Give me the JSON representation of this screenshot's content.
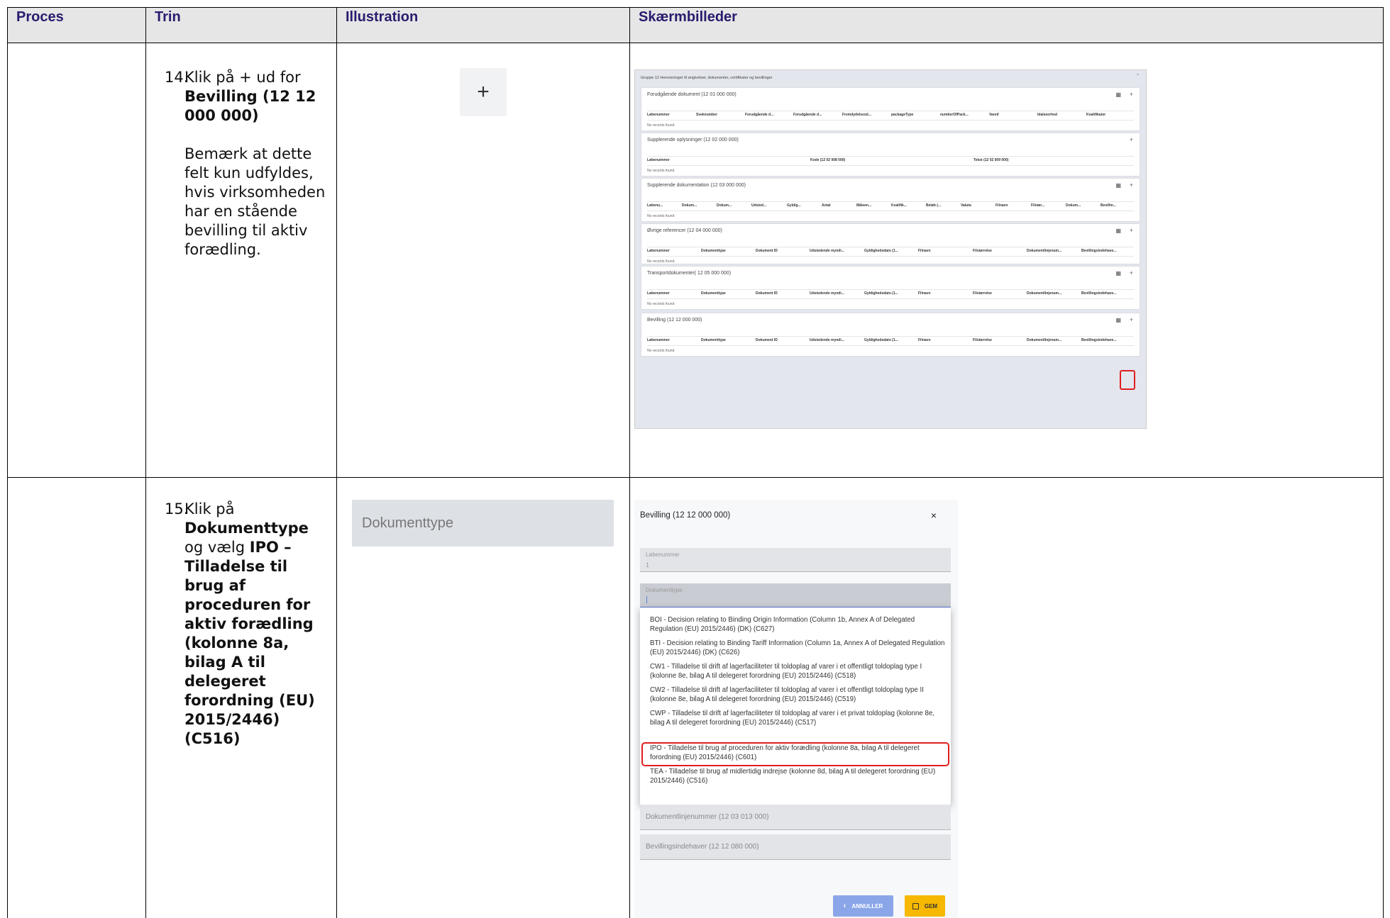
{
  "headers": {
    "proces": "Proces",
    "trin": "Trin",
    "illustration": "Illustration",
    "skaermbilleder": "Skærmbilleder"
  },
  "step14": {
    "number": "14.",
    "text_pre": "Klik på + ud for",
    "text_bold": "Bevilling (12 12 000 000)",
    "note": "Bemærk at dette felt kun udfyldes, hvis virksomheden har en stående bevilling til aktiv forædling.",
    "illustration_symbol": "+"
  },
  "screenshot1": {
    "group_title": "Gruppe 12 Henvisninger til angivelser, dokumenter, certifikater og bevillinger",
    "collapse_icon": "chevron-up-icon",
    "panels": [
      {
        "title": "Forudgående dokument (12 01 000 000)",
        "columns": [
          "Løbenummer",
          "Sveknumber",
          "Forudgående d...",
          "Forudgående d...",
          "Fremdydelsesd...",
          "packageType",
          "numberOfPack...",
          "Varetl",
          "Idalseorhed",
          "Kvalifikator"
        ],
        "empty": "No records found",
        "has_grid_icon": true
      },
      {
        "title": "Supplerende oplysninger (12 02 000 000)",
        "columns": [
          "Løbenummer",
          "Kode (12 02 008 000)",
          "Tekst (12 02 009 000)"
        ],
        "empty": "No records found",
        "has_grid_icon": false
      },
      {
        "title": "Supplerende dokumentation (12 03 000 000)",
        "columns": [
          "Løbenu...",
          "Dokum...",
          "Dokum...",
          "Udsted...",
          "Gyldig...",
          "Antal",
          "Måleen...",
          "Kvalifik...",
          "Beløb (...",
          "Valuta",
          "Filnavn",
          "Filstør...",
          "Dokum...",
          "Bevillin..."
        ],
        "empty": "No records found",
        "has_grid_icon": true
      },
      {
        "title": "Øvrige referencer (12 04 000 000)",
        "columns": [
          "Løbenummer",
          "Dokumenttype",
          "Dokument ID",
          "Udstedende myndi...",
          "Gyldighedsdato (1...",
          "Filnavn",
          "Filstørrelse",
          "Dokumentlinjenum...",
          "Bevillingsindehave..."
        ],
        "empty": "No records found",
        "has_grid_icon": true
      },
      {
        "title": "Transportdokumenter( 12 05 000 000)",
        "columns": [
          "Løbenummer",
          "Dokumenttype",
          "Dokument ID",
          "Udstedende myndi...",
          "Gyldighedsdato (1...",
          "Filnavn",
          "Filstørrelse",
          "Dokumentlinjenum...",
          "Bevillingsindehave..."
        ],
        "empty": "No records found",
        "has_grid_icon": true
      },
      {
        "title": "Bevilling (12 12 000 000)",
        "columns": [
          "Løbenummer",
          "Dokumenttype",
          "Dokument ID",
          "Udstedende myndi...",
          "Gyldighedsdato (1...",
          "Filnavn",
          "Filstørrelse",
          "Dokumentlinjenum...",
          "Bevillingsindehave..."
        ],
        "empty": "No records found",
        "has_grid_icon": true
      }
    ],
    "plus_symbol": "+",
    "grid_icon_symbol": "▦"
  },
  "step15": {
    "number": "15.",
    "text_pre": "Klik på",
    "text_bold1": "Dokumenttype",
    "text_mid": "og vælg",
    "text_bold2": "IPO – Tilladelse til brug af proceduren for aktiv forædling (kolonne 8a, bilag A til delegeret forordning (EU) 2015/2446) (C516)",
    "illustration_field": "Dokumenttype"
  },
  "screenshot2": {
    "title": "Bevilling (12 12 000 000)",
    "close_symbol": "×",
    "field_lobenummer_label": "Løbenummer",
    "field_lobenummer_value": "1",
    "field_dokumenttype_label": "Dokumenttype",
    "options": [
      "BOI - Decision relating to Binding Origin Information (Column 1b, Annex A of Delegated Regulation (EU) 2015/2446) (DK) (C627)",
      "BTI - Decision relating to Binding Tariff Information (Column 1a, Annex A of Delegated Regulation (EU) 2015/2446) (DK) (C626)",
      "CW1 - Tilladelse til drift af lagerfaciliteter til toldoplag af varer i et offentligt toldoplag type I (kolonne 8e, bilag A til delegeret forordning (EU) 2015/2446) (C518)",
      "CW2 - Tilladelse til drift af lagerfaciliteter til toldoplag af varer i et offentligt toldoplag type II (kolonne 8e, bilag A til delegeret forordning (EU) 2015/2446) (C519)",
      "CWP - Tilladelse til drift af lagerfaciliteter til toldoplag af varer i et privat toldoplag (kolonne 8e, bilag A til delegeret forordning (EU) 2015/2446) (C517)",
      "IPO - Tilladelse til brug af proceduren for aktiv forædling (kolonne 8a, bilag A til delegeret forordning (EU) 2015/2446) (C601)",
      "TEA - Tilladelse til brug af midlertidig indrejse (kolonne 8d, bilag A til delegeret forordning (EU) 2015/2446) (C516)"
    ],
    "field_dokumentlinjenummer": "Dokumentlinjenummer (12 03 013 000)",
    "field_bevillingsindehaver": "Bevillingsindehaver (12 12 080 000)",
    "cancel_label": "ANNULLER",
    "cancel_icon": "‹",
    "save_label": "GEM",
    "save_icon": "floppy-disk-icon"
  }
}
